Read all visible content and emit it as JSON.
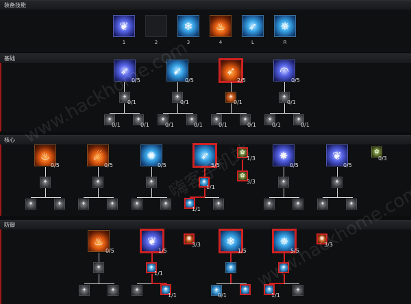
{
  "sections": {
    "equipped": {
      "title": "装备技能"
    },
    "basic": {
      "title": "基础"
    },
    "core": {
      "title": "核心"
    },
    "defense": {
      "title": "防御"
    }
  },
  "equipped_slots": [
    {
      "key": "1",
      "icon": "frost-tree-icon",
      "type": "arcane"
    },
    {
      "key": "2",
      "icon": "empty-slot",
      "type": "empty"
    },
    {
      "key": "3",
      "icon": "ice-shield-icon",
      "type": "ice"
    },
    {
      "key": "4",
      "icon": "fire-shield-icon",
      "type": "fire"
    },
    {
      "key": "L",
      "icon": "frost-bolt-icon",
      "type": "ice"
    },
    {
      "key": "R",
      "icon": "ice-shards-icon",
      "type": "ice"
    }
  ],
  "ranks": {
    "basic_skill_1": "0/5",
    "basic_skill_2": "0/5",
    "basic_skill_3": "2/5",
    "basic_skill_4": "0/5",
    "basic_upgrade_1": "0/1",
    "basic_upgrade_2": "0/1",
    "basic_upgrade_3": "0/1",
    "basic_upgrade_4": "0/1",
    "basic_sub_1a": "0/1",
    "basic_sub_1b": "0/1",
    "basic_sub_2a": "0/1",
    "basic_sub_2b": "0/1",
    "basic_sub_3a": "0/1",
    "basic_sub_3b": "0/1",
    "basic_sub_4a": "0/1",
    "basic_sub_4b": "0/1",
    "core_skill_1": "0/5",
    "core_skill_2": "0/5",
    "core_skill_3": "0/5",
    "core_skill_4": "5/5",
    "core_skill_5": "0/5",
    "core_skill_6": "0/5",
    "core_passive_1": "1/3",
    "core_passive_2": "3/3",
    "core_passive_3": "0/3",
    "core_upgrade_4": "1/1",
    "core_sub_4a": "1/1",
    "defense_skill_1": "0/5",
    "defense_skill_2": "1/5",
    "defense_skill_3": "1/5",
    "defense_skill_4": "5/5",
    "defense_passive_1": "3/3",
    "defense_passive_2": "3/3",
    "defense_upgrade_2": "1/1",
    "defense_sub_2b": "1/1",
    "defense_sub_3a": "0/1",
    "defense_sub_4a": "1/1"
  },
  "watermarks": [
    "www.hackhome.com",
    "嗨客手机站",
    "www.hackhome.com"
  ]
}
